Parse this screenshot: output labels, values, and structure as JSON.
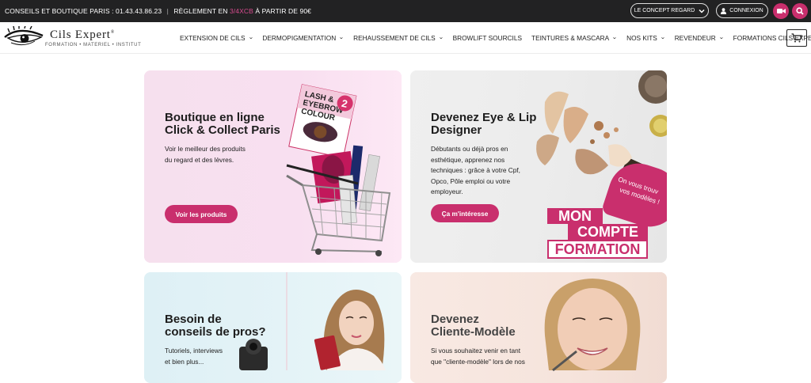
{
  "topbar": {
    "contact": "CONSEILS ET BOUTIQUE PARIS : 01.43.43.86.23",
    "separator": "|",
    "payment_prefix": "RÈGLEMENT EN ",
    "payment_highlight": "3/4XCB",
    "payment_suffix": " À PARTIR DE 90€",
    "concept_label": "LE CONCEPT REGARD",
    "connexion_label": "CONNEXION",
    "video_icon": "video-camera-icon",
    "search_icon": "search-icon"
  },
  "logo": {
    "name": "Cils Expert",
    "registered": "®",
    "tagline": "FORMATION • MATERIEL • INSTITUT"
  },
  "nav": {
    "items": [
      {
        "label": "EXTENSION DE CILS",
        "dropdown": "⌄"
      },
      {
        "label": "DERMOPIGMENTATION",
        "dropdown": "⌄"
      },
      {
        "label": "REHAUSSEMENT DE CILS",
        "dropdown": "⌄"
      },
      {
        "label": "BROWLIFT SOURCILS",
        "dropdown": ""
      },
      {
        "label": "TEINTURES & MASCARA",
        "dropdown": "⌄"
      },
      {
        "label": "NOS KITS",
        "dropdown": "⌄"
      },
      {
        "label": "REVENDEUR",
        "dropdown": "⌄"
      },
      {
        "label": "FORMATIONS CILS EXPERT",
        "dropdown": "⌄"
      }
    ],
    "cart_icon": "cart-icon"
  },
  "cards": {
    "boutique": {
      "title_line1": "Boutique en ligne",
      "title_line2": "Click & Collect Paris",
      "text_line1": "Voir le meilleur des produits",
      "text_line2": "du regard et des lèvres.",
      "button": "Voir les produits",
      "product_text1": "LASH &",
      "product_text2": "EYEBROW",
      "product_text3": "COLOUR",
      "product_number": "2"
    },
    "designer": {
      "title_line1": "Devenez Eye & Lip",
      "title_line2": "Designer",
      "text_line1": "Débutants ou déjà pros en",
      "text_line2": "esthétique, apprenez nos",
      "text_line3": "techniques : grâce à votre Cpf,",
      "text_line4": "Opco, Pôle emploi ou votre",
      "text_line5": "employeur.",
      "button": "Ça m'intéresse",
      "badge_line1": "MON",
      "badge_line2": "COMPTE",
      "badge_line3": "FORMATION",
      "bubble_line1": "On vous trouv",
      "bubble_line2": "vos modèles !"
    },
    "conseils": {
      "title_line1": "Besoin de",
      "title_line2": "conseils de pros?",
      "text_line1": "Tutoriels, interviews",
      "text_line2": "et bien plus..."
    },
    "modele": {
      "title_line1": "Devenez",
      "title_line2": "Cliente-Modèle",
      "text_line1": "Si vous souhaitez venir en tant",
      "text_line2": "que \"cliente-modèle\" lors de nos"
    }
  },
  "colors": {
    "brand_pink": "#c92f6d",
    "topbar_bg": "#222223",
    "accent_pink_text": "#d64b8e"
  }
}
